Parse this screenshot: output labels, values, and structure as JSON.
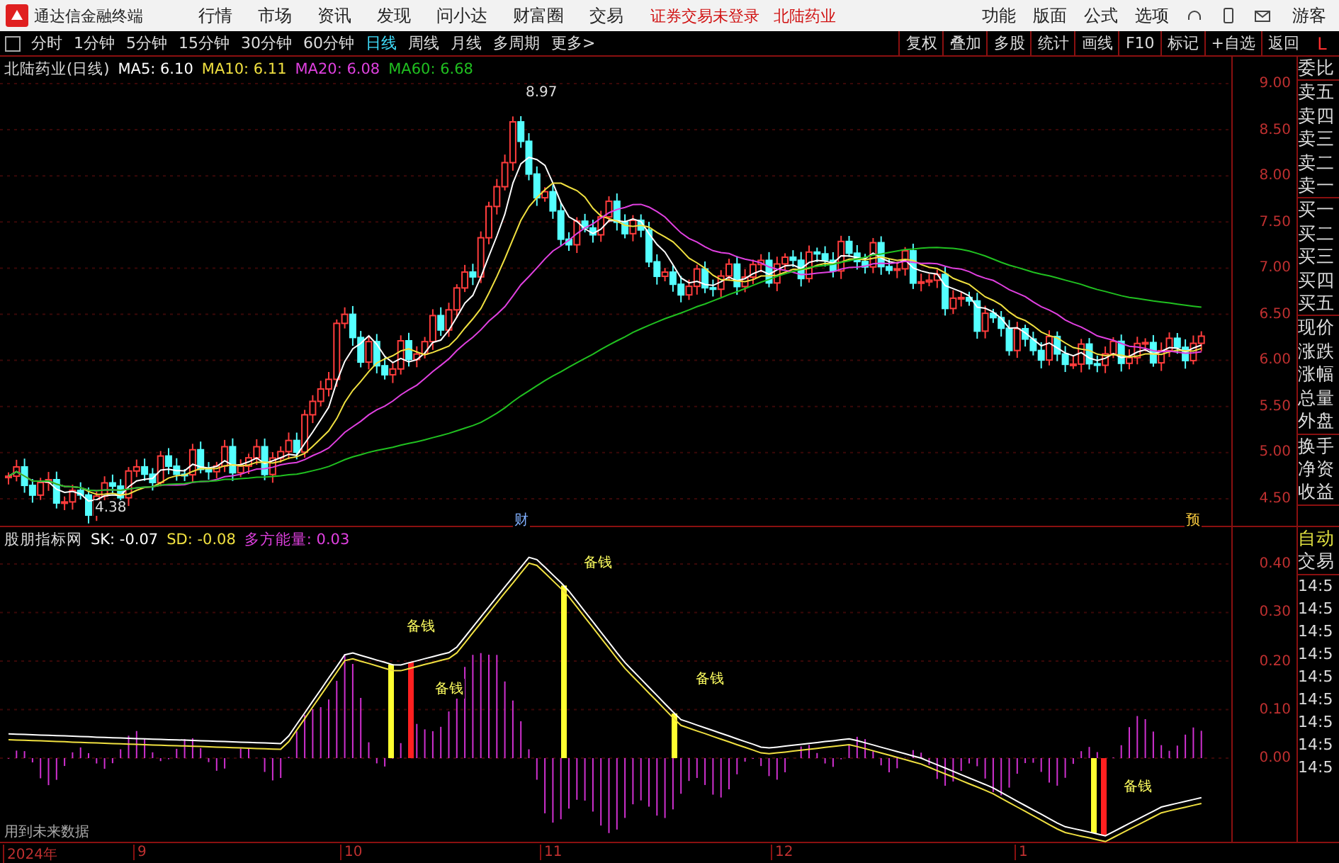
{
  "top_bar": {
    "app_title": "通达信金融终端",
    "menu": [
      "行情",
      "市场",
      "资讯",
      "发现",
      "问小达",
      "财富圈",
      "交易"
    ],
    "notices": [
      "证券交易未登录",
      "北陆药业"
    ],
    "right_menu": [
      "功能",
      "版面",
      "公式",
      "选项"
    ],
    "user": "游客"
  },
  "period_bar": {
    "periods": [
      {
        "label": "分时",
        "selected": false
      },
      {
        "label": "1分钟",
        "selected": false
      },
      {
        "label": "5分钟",
        "selected": false
      },
      {
        "label": "15分钟",
        "selected": false
      },
      {
        "label": "30分钟",
        "selected": false
      },
      {
        "label": "60分钟",
        "selected": false
      },
      {
        "label": "日线",
        "selected": true
      },
      {
        "label": "周线",
        "selected": false
      },
      {
        "label": "月线",
        "selected": false
      },
      {
        "label": "多周期",
        "selected": false
      },
      {
        "label": "更多>",
        "selected": false
      }
    ],
    "tools": [
      "复权",
      "叠加",
      "多股",
      "统计",
      "画线",
      "F10",
      "标记",
      "+自选",
      "返回"
    ],
    "corner": "L"
  },
  "main_chart": {
    "title": "北陆药业(日线)",
    "legend": [
      {
        "label": "MA5: 6.10",
        "color": "#ffffff"
      },
      {
        "label": "MA10: 6.11",
        "color": "#f0e040"
      },
      {
        "label": "MA20: 6.08",
        "color": "#e040e0"
      },
      {
        "label": "MA60: 6.68",
        "color": "#20c020"
      }
    ],
    "high_label": "8.97",
    "low_label": "4.38",
    "event_marks": [
      {
        "label": "财",
        "kind": "finance"
      },
      {
        "label": "预",
        "kind": "forecast"
      }
    ],
    "price_axis": [
      "9.00",
      "8.50",
      "8.00",
      "7.50",
      "7.00",
      "6.50",
      "6.00",
      "5.50",
      "5.00",
      "4.50"
    ]
  },
  "indicator": {
    "title": "股朋指标网",
    "legend": [
      {
        "label": "SK: -0.07",
        "color": "#ffffff"
      },
      {
        "label": "SD: -0.08",
        "color": "#f0e040"
      },
      {
        "label": "多方能量: 0.03",
        "color": "#e040e0"
      }
    ],
    "signals": [
      "备钱",
      "备钱",
      "备钱",
      "备钱",
      "备钱"
    ],
    "note": "用到未来数据",
    "axis": [
      "0.40",
      "0.30",
      "0.20",
      "0.10",
      "0.00"
    ]
  },
  "date_axis": [
    "2024年",
    "9",
    "10",
    "11",
    "12",
    "1"
  ],
  "quote_panel": {
    "groups": [
      [
        "委比"
      ],
      [
        "卖五",
        "卖四",
        "卖三",
        "卖二",
        "卖一"
      ],
      [
        "买一",
        "买二",
        "买三",
        "买四",
        "买五"
      ],
      [
        "现价",
        "涨跌",
        "涨幅",
        "总量",
        "外盘"
      ],
      [
        "换手",
        "净资",
        "收益"
      ]
    ],
    "trade_header": [
      "自动",
      "交易"
    ],
    "times": [
      "14:5",
      "14:5",
      "14:5",
      "14:5",
      "14:5",
      "14:5",
      "14:5",
      "14:5",
      "14:5"
    ]
  }
}
